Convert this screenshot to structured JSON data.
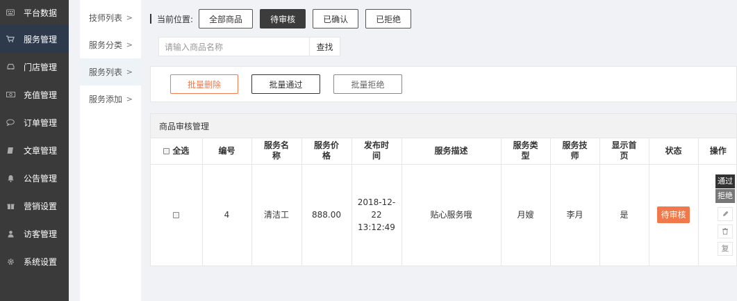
{
  "nav": {
    "items": [
      {
        "label": "平台数据",
        "icon": "keyboard-icon"
      },
      {
        "label": "服务管理",
        "icon": "cart-icon"
      },
      {
        "label": "门店管理",
        "icon": "car-icon"
      },
      {
        "label": "充值管理",
        "icon": "money-icon"
      },
      {
        "label": "订单管理",
        "icon": "chat-icon"
      },
      {
        "label": "文章管理",
        "icon": "book-icon"
      },
      {
        "label": "公告管理",
        "icon": "bell-icon"
      },
      {
        "label": "营销设置",
        "icon": "gift-icon"
      },
      {
        "label": "访客管理",
        "icon": "user-icon"
      },
      {
        "label": "系统设置",
        "icon": "gear-icon"
      }
    ],
    "active_index": 1,
    "active_color": "#2d3a4b"
  },
  "submenu": {
    "items": [
      {
        "label": "技师列表"
      },
      {
        "label": "服务分类"
      },
      {
        "label": "服务列表"
      },
      {
        "label": "服务添加"
      }
    ],
    "active_index": 2
  },
  "breadcrumb": {
    "label": "当前位置:",
    "filters": [
      "全部商品",
      "待审核",
      "已确认",
      "已拒绝"
    ],
    "active_filter": "待审核"
  },
  "search": {
    "placeholder": "请输入商品名称",
    "button_label": "查找"
  },
  "bulk": {
    "delete_label": "批量删除",
    "approve_label": "批量通过",
    "reject_label": "批量拒绝",
    "delete_color": "#ee7b4e"
  },
  "table": {
    "title": "商品审核管理",
    "headers": {
      "select_all": "全选",
      "id": "编号",
      "name": "服务名\n称",
      "price": "服务价\n格",
      "time": "发布时\n间",
      "desc": "服务描述",
      "type": "服务类\n型",
      "tech": "服务技\n师",
      "home": "显示首\n页",
      "status": "状态",
      "ops": "操作"
    },
    "rows": [
      {
        "id": "4",
        "name": "清洁工",
        "price": "888.00",
        "time": "2018-12-\n22\n13:12:49",
        "desc": "贴心服务哦",
        "type": "月嫂",
        "tech": "李月",
        "home": "是",
        "status": "待审核",
        "op_approve": "通过",
        "op_reject": "拒绝",
        "op_copy": "复"
      }
    ],
    "status_color": "#f0784a"
  }
}
